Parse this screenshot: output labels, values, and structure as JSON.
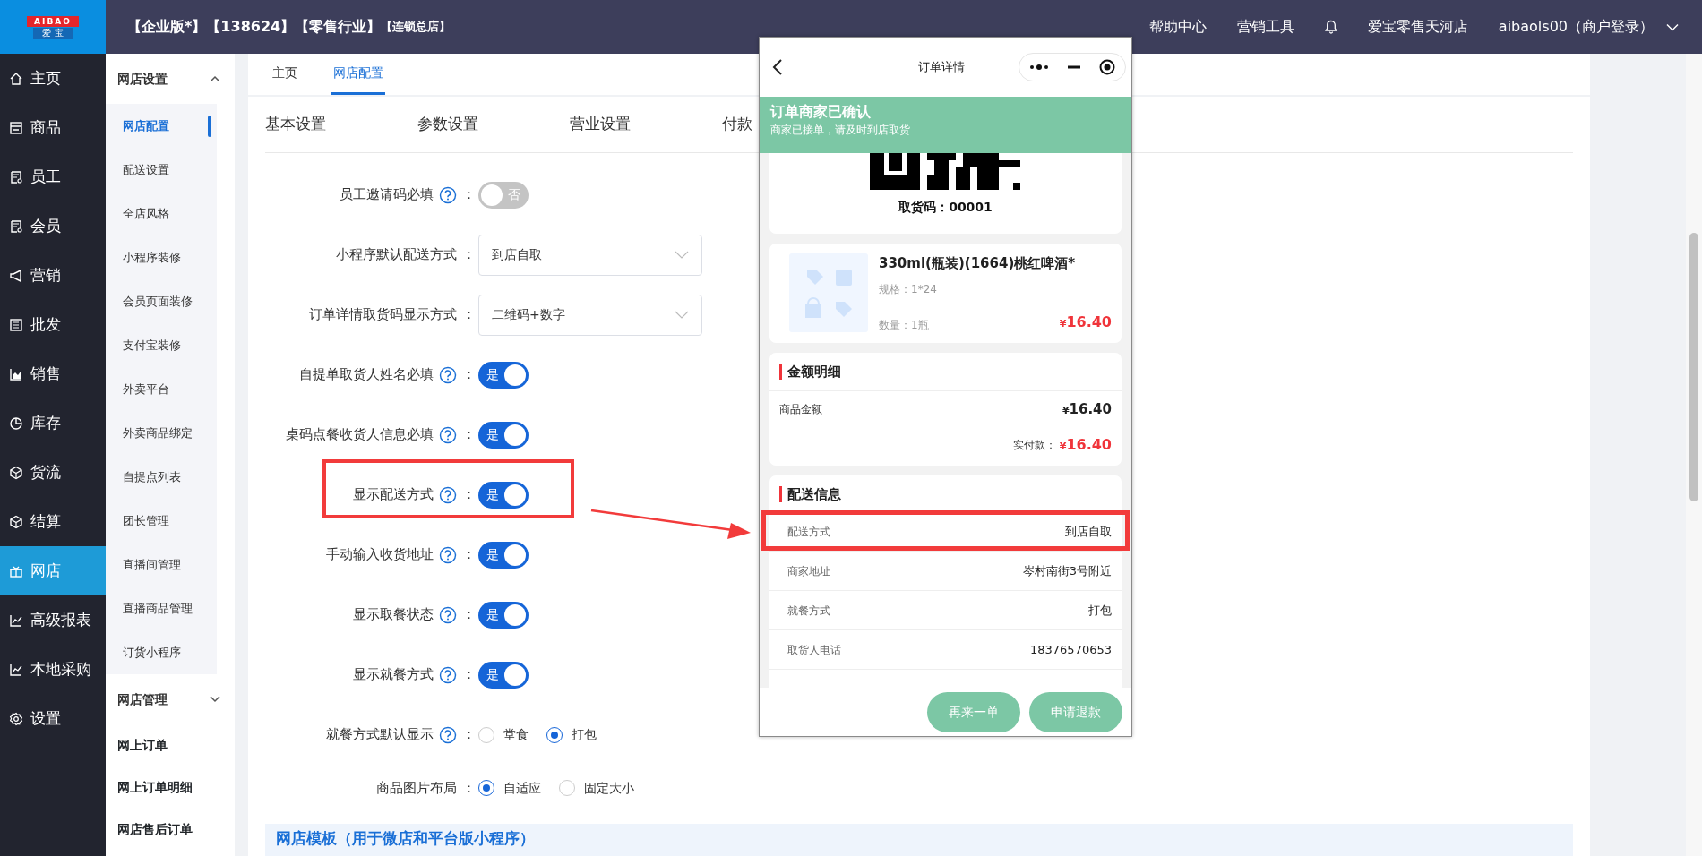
{
  "header": {
    "logo": {
      "title": "AIBAO",
      "subtitle": "爱 宝"
    },
    "title_parts": [
      {
        "text": "【企业版*】【138624】【零售行业】",
        "kind": "main"
      },
      {
        "text": "【连锁总店】",
        "kind": "tag"
      }
    ],
    "links": [
      "帮助中心",
      "营销工具"
    ],
    "store": "爱宝零售天河店",
    "user": "aibaols00（商户登录）"
  },
  "sidebar": {
    "items": [
      {
        "label": "主页",
        "selected": false
      },
      {
        "label": "商品",
        "selected": false
      },
      {
        "label": "员工",
        "selected": false
      },
      {
        "label": "会员",
        "selected": false
      },
      {
        "label": "营销",
        "selected": false
      },
      {
        "label": "批发",
        "selected": false
      },
      {
        "label": "销售",
        "selected": false
      },
      {
        "label": "库存",
        "selected": false
      },
      {
        "label": "货流",
        "selected": false
      },
      {
        "label": "结算",
        "selected": false
      },
      {
        "label": "网店",
        "selected": true
      },
      {
        "label": "高级报表",
        "selected": false
      },
      {
        "label": "本地采购",
        "selected": false
      },
      {
        "label": "设置",
        "selected": false
      }
    ]
  },
  "subnav": {
    "sections": [
      {
        "kind": "group",
        "label": "网店设置",
        "expanded": true,
        "children": [
          {
            "label": "网店配置",
            "selected": true
          },
          {
            "label": "配送设置",
            "selected": false
          },
          {
            "label": "全店风格",
            "selected": false
          },
          {
            "label": "小程序装修",
            "selected": false
          },
          {
            "label": "会员页面装修",
            "selected": false
          },
          {
            "label": "支付宝装修",
            "selected": false
          },
          {
            "label": "外卖平台",
            "selected": false
          },
          {
            "label": "外卖商品绑定",
            "selected": false
          },
          {
            "label": "自提点列表",
            "selected": false
          },
          {
            "label": "团长管理",
            "selected": false
          },
          {
            "label": "直播间管理",
            "selected": false
          },
          {
            "label": "直播商品管理",
            "selected": false
          },
          {
            "label": "订货小程序",
            "selected": false
          }
        ]
      },
      {
        "kind": "group",
        "label": "网店管理",
        "expanded": false
      },
      {
        "kind": "link",
        "label": "网上订单"
      },
      {
        "kind": "link",
        "label": "网上订单明细"
      },
      {
        "kind": "link",
        "label": "网店售后订单"
      }
    ]
  },
  "page_tabs": [
    {
      "label": "主页",
      "selected": false
    },
    {
      "label": "网店配置",
      "selected": true
    }
  ],
  "settings_tabs": [
    "基本设置",
    "参数设置",
    "营业设置",
    "付款"
  ],
  "form": {
    "rows": [
      {
        "kind": "toggle",
        "label": "员工邀请码必填",
        "colon": "：",
        "help": true,
        "on": false,
        "state_text": "否",
        "highlighted": false
      },
      {
        "kind": "select",
        "label": "小程序默认配送方式",
        "colon": "：",
        "help": false,
        "value": "到店自取",
        "highlighted": false
      },
      {
        "kind": "select",
        "label": "订单详情取货码显示方式",
        "colon": "：",
        "help": false,
        "value": "二维码+数字",
        "highlighted": false
      },
      {
        "kind": "toggle",
        "label": "自提单取货人姓名必填",
        "colon": "：",
        "help": true,
        "on": true,
        "state_text": "是",
        "highlighted": false
      },
      {
        "kind": "toggle",
        "label": "桌码点餐收货人信息必填",
        "colon": "：",
        "help": true,
        "on": true,
        "state_text": "是",
        "highlighted": false
      },
      {
        "kind": "toggle",
        "label": "显示配送方式",
        "colon": "：",
        "help": true,
        "on": true,
        "state_text": "是",
        "highlighted": true
      },
      {
        "kind": "toggle",
        "label": "手动输入收货地址",
        "colon": "：",
        "help": true,
        "on": true,
        "state_text": "是",
        "highlighted": false
      },
      {
        "kind": "toggle",
        "label": "显示取餐状态",
        "colon": "：",
        "help": true,
        "on": true,
        "state_text": "是",
        "highlighted": false
      },
      {
        "kind": "toggle",
        "label": "显示就餐方式",
        "colon": "：",
        "help": true,
        "on": true,
        "state_text": "是",
        "highlighted": false
      },
      {
        "kind": "radio",
        "label": "就餐方式默认显示",
        "colon": "：",
        "help": true,
        "highlighted": false,
        "options": [
          {
            "label": "堂食",
            "selected": false
          },
          {
            "label": "打包",
            "selected": true
          }
        ]
      },
      {
        "kind": "radio",
        "label": "商品图片布局",
        "colon": "：",
        "help": false,
        "highlighted": false,
        "options": [
          {
            "label": "自适应",
            "selected": true
          },
          {
            "label": "固定大小",
            "selected": false
          }
        ]
      }
    ]
  },
  "section_title": "网店模板（用于微店和平台版小程序）",
  "phone": {
    "title": "订单详情",
    "banner": {
      "title": "订单商家已确认",
      "subtitle": "商家已接单，请及时到店取货"
    },
    "pickup_code": "取货码：00001",
    "product": {
      "name": "330ml(瓶装)(1664)桃红啤酒*",
      "spec": "规格：1*24",
      "quantity": "数量：1瓶",
      "currency": "¥",
      "price": "16.40"
    },
    "amount": {
      "title": "金额明细",
      "rows": [
        {
          "label": "商品金额",
          "currency": "¥",
          "value": "16.40"
        }
      ],
      "paid_label": "实付款：",
      "paid_currency": "¥",
      "paid_value": "16.40"
    },
    "delivery": {
      "title": "配送信息",
      "rows": [
        {
          "label": "配送方式",
          "value": "到店自取",
          "highlighted": true
        },
        {
          "label": "商家地址",
          "value": "岑村南街3号附近",
          "highlighted": false
        },
        {
          "label": "就餐方式",
          "value": "打包",
          "highlighted": false
        },
        {
          "label": "取货人电话",
          "value": "18376570653",
          "highlighted": false
        }
      ]
    },
    "buttons": [
      "再来一单",
      "申请退款"
    ]
  }
}
